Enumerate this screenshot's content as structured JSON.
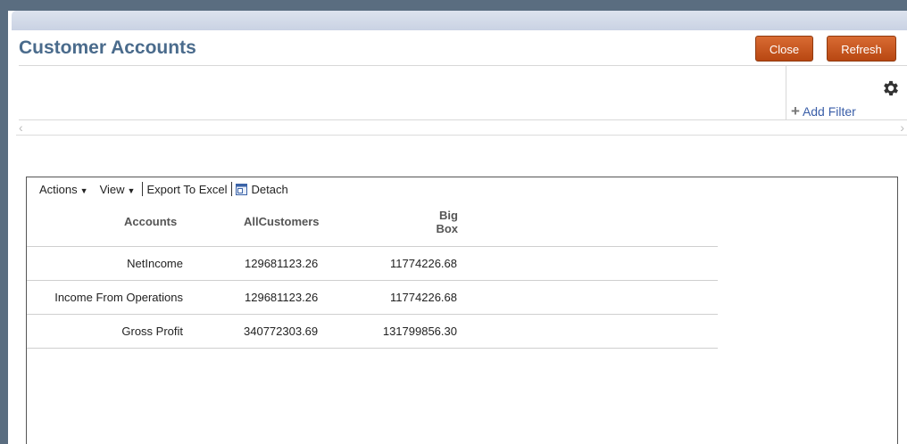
{
  "page": {
    "title": "Customer Accounts",
    "close_label": "Close",
    "refresh_label": "Refresh",
    "accent_color": "#c4551f"
  },
  "filter": {
    "add_filter_label": "Add Filter",
    "settings_icon": "gear-icon"
  },
  "toolbar": {
    "actions_label": "Actions",
    "view_label": "View",
    "export_label": "Export To Excel",
    "detach_label": "Detach"
  },
  "table": {
    "headers": {
      "accounts": "Accounts",
      "all_customers": "AllCustomers",
      "big_box_line1": "Big",
      "big_box_line2": "Box"
    },
    "rows": [
      {
        "account": "NetIncome",
        "all_customers": "129681123.26",
        "big_box": "11774226.68"
      },
      {
        "account": "Income From Operations",
        "all_customers": "129681123.26",
        "big_box": "11774226.68"
      },
      {
        "account": "Gross Profit",
        "all_customers": "340772303.69",
        "big_box": "131799856.30"
      }
    ]
  }
}
